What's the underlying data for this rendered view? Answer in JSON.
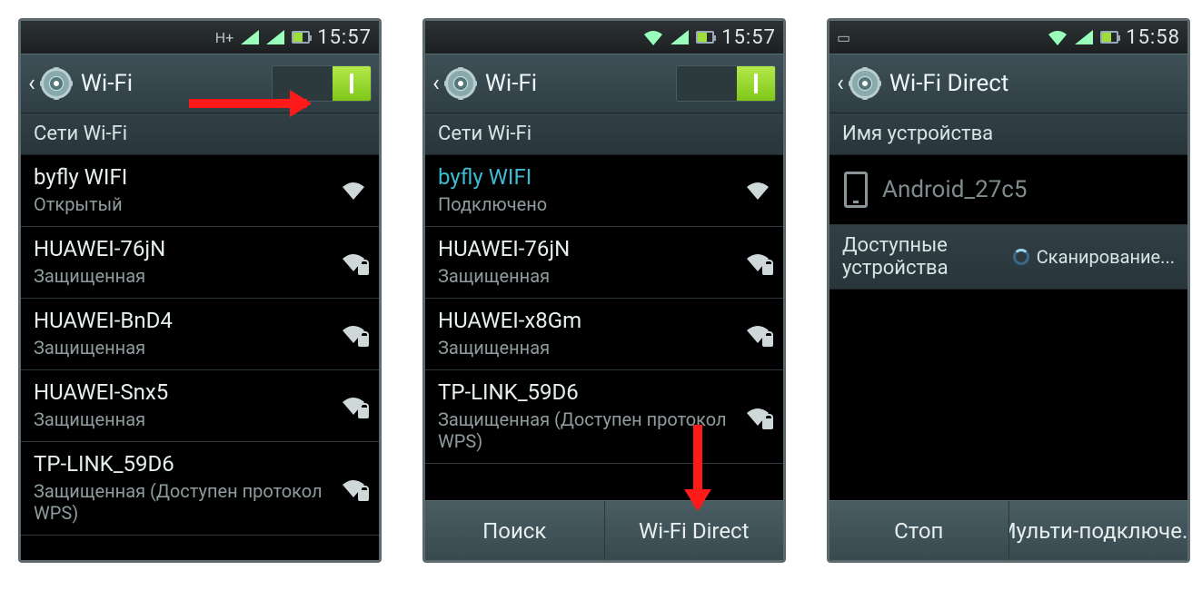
{
  "screens": [
    {
      "time": "15:57",
      "net_indicator": "H+",
      "title": "Wi-Fi",
      "toggle_on": true,
      "section": "Сети Wi-Fi",
      "networks": [
        {
          "name": "byfly WIFI",
          "sub": "Открытый",
          "secured": false,
          "connected": false
        },
        {
          "name": "HUAWEI-76jN",
          "sub": "Защищенная",
          "secured": true,
          "connected": false
        },
        {
          "name": "HUAWEI-BnD4",
          "sub": "Защищенная",
          "secured": true,
          "connected": false
        },
        {
          "name": "HUAWEI-Snx5",
          "sub": "Защищенная",
          "secured": true,
          "connected": false
        },
        {
          "name": "TP-LINK_59D6",
          "sub": "Защищенная (Доступен протокол WPS)",
          "secured": true,
          "connected": false
        }
      ]
    },
    {
      "time": "15:57",
      "title": "Wi-Fi",
      "toggle_on": true,
      "section": "Сети Wi-Fi",
      "networks": [
        {
          "name": "byfly WIFI",
          "sub": "Подключено",
          "secured": false,
          "connected": true
        },
        {
          "name": "HUAWEI-76jN",
          "sub": "Защищенная",
          "secured": true,
          "connected": false
        },
        {
          "name": "HUAWEI-x8Gm",
          "sub": "Защищенная",
          "secured": true,
          "connected": false
        },
        {
          "name": "TP-LINK_59D6",
          "sub": "Защищенная (Доступен протокол WPS)",
          "secured": true,
          "connected": false
        }
      ],
      "bottom": [
        "Поиск",
        "Wi-Fi Direct"
      ]
    },
    {
      "time": "15:58",
      "title": "Wi-Fi Direct",
      "section": "Имя устройства",
      "device_name": "Android_27c5",
      "avail_label": "Доступные устройства",
      "scan_label": "Сканирование...",
      "bottom": [
        "Стоп",
        "Мульти-подключе..."
      ]
    }
  ]
}
